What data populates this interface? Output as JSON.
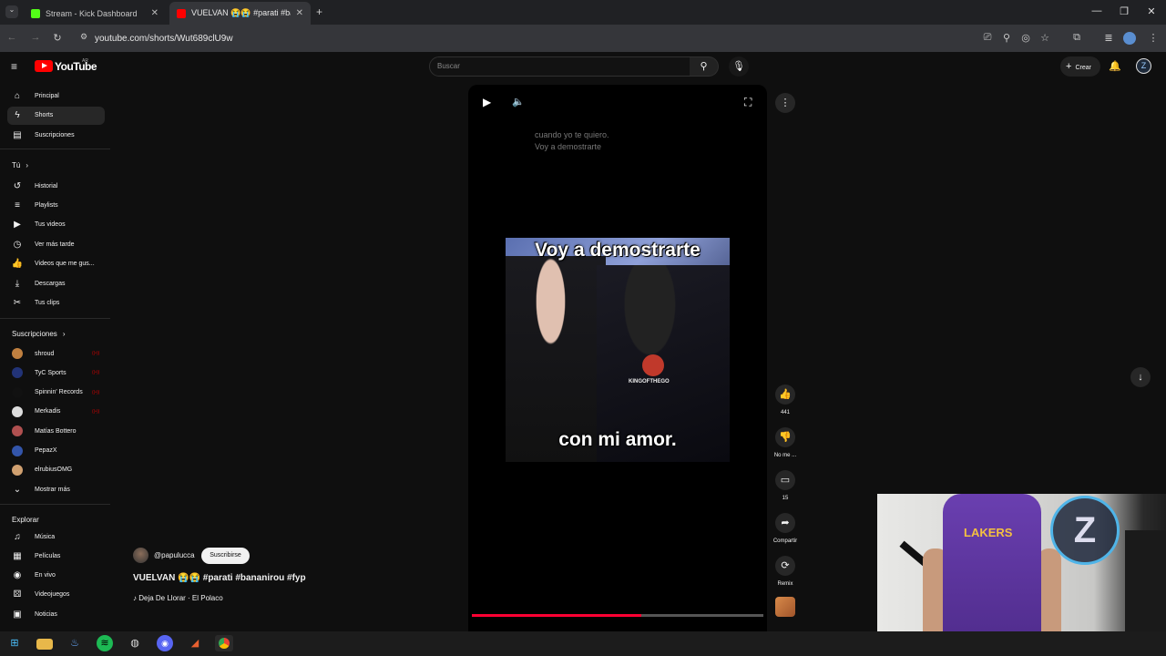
{
  "browser": {
    "tabs": [
      {
        "label": "Stream - Kick Dashboard",
        "active": false
      },
      {
        "label": "VUELVAN 😭😭 #parati #banan",
        "active": true
      }
    ],
    "new_tab": "+",
    "url": "youtube.com/shorts/Wut689clU9w",
    "window_controls": {
      "minimize": "—",
      "maximize": "❐",
      "close": "✕"
    }
  },
  "header": {
    "logo": "YouTube",
    "country": "AR",
    "search_placeholder": "Buscar",
    "create_label": "Crear"
  },
  "sidebar": {
    "main": [
      {
        "label": "Principal",
        "icon": "home-icon",
        "glyph": "⌂",
        "selected": false
      },
      {
        "label": "Shorts",
        "icon": "shorts-icon",
        "glyph": "ϟ",
        "selected": true
      },
      {
        "label": "Suscripciones",
        "icon": "subscriptions-icon",
        "glyph": "▤",
        "selected": false
      }
    ],
    "you_heading": "Tú",
    "you": [
      {
        "label": "Historial",
        "icon": "history-icon",
        "glyph": "↺"
      },
      {
        "label": "Playlists",
        "icon": "playlists-icon",
        "glyph": "≡"
      },
      {
        "label": "Tus videos",
        "icon": "your-videos-icon",
        "glyph": "▶"
      },
      {
        "label": "Ver más tarde",
        "icon": "watch-later-icon",
        "glyph": "◷"
      },
      {
        "label": "Videos que me gus...",
        "icon": "liked-icon",
        "glyph": "👍"
      },
      {
        "label": "Descargas",
        "icon": "downloads-icon",
        "glyph": "⤓"
      },
      {
        "label": "Tus clips",
        "icon": "clips-icon",
        "glyph": "✂"
      }
    ],
    "subs_heading": "Suscripciones",
    "subs": [
      {
        "label": "shroud",
        "color": "#c08040",
        "live": true
      },
      {
        "label": "TyC Sports",
        "color": "#223377",
        "live": true
      },
      {
        "label": "Spinnin' Records",
        "color": "#111111",
        "live": true
      },
      {
        "label": "Merkadis",
        "color": "#dddddd",
        "live": true
      },
      {
        "label": "Matías Bottero",
        "color": "#b05050",
        "live": false
      },
      {
        "label": "PepazX",
        "color": "#3355aa",
        "live": false
      },
      {
        "label": "elrubiusOMG",
        "color": "#d0a070",
        "live": false
      }
    ],
    "show_more": "Mostrar más",
    "explore_heading": "Explorar",
    "explore": [
      {
        "label": "Música",
        "icon": "music-icon",
        "glyph": "♫"
      },
      {
        "label": "Películas",
        "icon": "movies-icon",
        "glyph": "▦"
      },
      {
        "label": "En vivo",
        "icon": "live-icon",
        "glyph": "◉"
      },
      {
        "label": "Videojuegos",
        "icon": "gaming-icon",
        "glyph": "⚄"
      },
      {
        "label": "Noticias",
        "icon": "news-icon",
        "glyph": "▣"
      }
    ]
  },
  "short": {
    "lyrics": "cuando yo te quiero.\nVoy a demostrarte",
    "caption_top": "Voy a demostrarte",
    "caption_bottom": "con mi amor.",
    "logo_text": "KINGOFTHEGO",
    "progress": 0.58,
    "channel": "@papulucca",
    "subscribe": "Suscribirse",
    "title": "VUELVAN 😭😭 #parati #bananirou #fyp",
    "music": "♪ Deja De Llorar · El Polaco"
  },
  "actions": {
    "likes": "441",
    "dislike_label": "No me ...",
    "comments": "15",
    "share_label": "Compartir",
    "remix_label": "Remix"
  },
  "webcam": {
    "shirt_text": "LAKERS",
    "logo_letter": "Z"
  }
}
